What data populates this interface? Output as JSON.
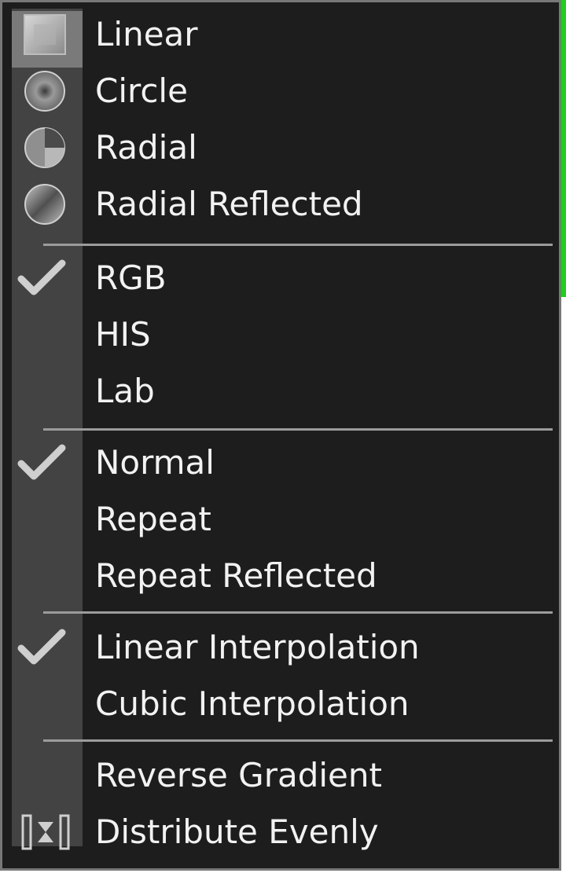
{
  "menu": {
    "shape": {
      "linear": "Linear",
      "circle": "Circle",
      "radial": "Radial",
      "radial_reflected": "Radial Reflected"
    },
    "color_model": {
      "rgb": "RGB",
      "his": "HIS",
      "lab": "Lab",
      "checked": "RGB"
    },
    "repeat_mode": {
      "normal": "Normal",
      "repeat": "Repeat",
      "repeat_reflected": "Repeat Reflected",
      "checked": "Normal"
    },
    "interpolation": {
      "linear": "Linear Interpolation",
      "cubic": "Cubic Interpolation",
      "checked": "Linear Interpolation"
    },
    "actions": {
      "reverse": "Reverse Gradient",
      "distribute": "Distribute Evenly"
    }
  },
  "icons": {
    "linear": "linear-gradient-icon",
    "circle": "circle-gradient-icon",
    "radial": "radial-gradient-icon",
    "radial_reflected": "radial-reflected-gradient-icon",
    "checkmark": "checkmark-icon",
    "distribute": "distribute-evenly-icon"
  },
  "colors": {
    "menu_bg": "#1d1d1d",
    "gutter_bg": "#434343",
    "highlight_bg": "#7a7a7a",
    "text": "#f2f2f2",
    "separator": "#9c9c9c",
    "accent_edge": "#22cc22"
  }
}
